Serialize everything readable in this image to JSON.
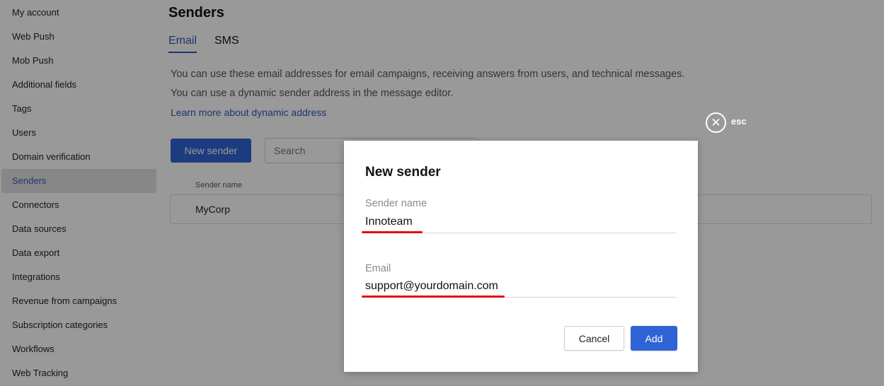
{
  "sidebar": {
    "items": [
      {
        "label": "My account"
      },
      {
        "label": "Web Push"
      },
      {
        "label": "Mob Push"
      },
      {
        "label": "Additional fields"
      },
      {
        "label": "Tags"
      },
      {
        "label": "Users"
      },
      {
        "label": "Domain verification"
      },
      {
        "label": "Senders",
        "active": true
      },
      {
        "label": "Connectors"
      },
      {
        "label": "Data sources"
      },
      {
        "label": "Data export"
      },
      {
        "label": "Integrations"
      },
      {
        "label": "Revenue from campaigns"
      },
      {
        "label": "Subscription categories"
      },
      {
        "label": "Workflows"
      },
      {
        "label": "Web Tracking"
      }
    ]
  },
  "main": {
    "title": "Senders",
    "tabs": [
      {
        "label": "Email",
        "active": true
      },
      {
        "label": "SMS",
        "active": false
      }
    ],
    "description_line1": "You can use these email addresses for email campaigns, receiving answers from users, and technical messages.",
    "description_line2": "You can use a dynamic sender address in the message editor.",
    "learn_more_link": "Learn more about dynamic address",
    "new_sender_button": "New sender",
    "search": {
      "placeholder": "Search",
      "value": ""
    },
    "table": {
      "columns": [
        "Sender name"
      ],
      "rows": [
        [
          "MyCorp"
        ]
      ]
    }
  },
  "overlay": {
    "esc_label": "esc",
    "close_glyph": "✕"
  },
  "dialog": {
    "title": "New sender",
    "sender_name_label": "Sender name",
    "sender_name_value": "Innoteam",
    "email_label": "Email",
    "email_value": "support@yourdomain.com",
    "cancel_button": "Cancel",
    "add_button": "Add"
  },
  "colors": {
    "accent": "#2f64d6",
    "link": "#2f5ab8",
    "annotation": "#e01010"
  }
}
